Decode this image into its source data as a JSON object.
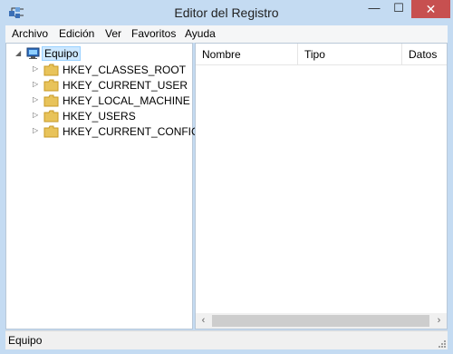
{
  "window": {
    "title": "Editor del Registro",
    "controls": {
      "minimize": "—",
      "maximize": "☐",
      "close": "✕"
    }
  },
  "menu": [
    "Archivo",
    "Edición",
    "Ver",
    "Favoritos",
    "Ayuda"
  ],
  "tree": {
    "root": "Equipo",
    "root_icon": "computer-icon",
    "children": [
      "HKEY_CLASSES_ROOT",
      "HKEY_CURRENT_USER",
      "HKEY_LOCAL_MACHINE",
      "HKEY_USERS",
      "HKEY_CURRENT_CONFIG"
    ],
    "child_icon": "folder-icon"
  },
  "list": {
    "columns": [
      "Nombre",
      "Tipo",
      "Datos"
    ]
  },
  "statusbar": {
    "path": "Equipo"
  },
  "colors": {
    "frame": "#c4dbf2",
    "close_button": "#c75050",
    "selection": "#cde8ff",
    "folder": "#e8c35a"
  }
}
